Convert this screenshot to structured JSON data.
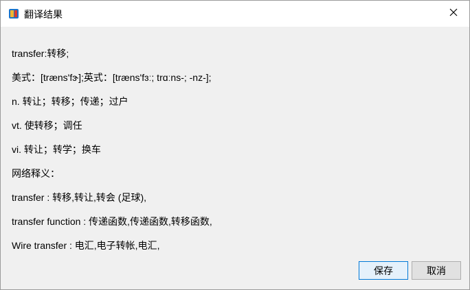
{
  "window": {
    "title": "翻译结果"
  },
  "content": {
    "lines": [
      "transfer:转移;",
      "美式：[træns'fɝ];英式：[træns'fɜː; trɑːns-; -nz-];",
      "n. 转让；转移；传递；过户",
      "vt. 使转移；调任",
      "vi. 转让；转学；换车",
      "网络释义：",
      "transfer : 转移,转让,转会 (足球),",
      "transfer function : 传递函数,传递函数,转移函数,",
      "Wire transfer : 电汇,电子转帐,电汇,"
    ]
  },
  "buttons": {
    "save": "保存",
    "cancel": "取消"
  },
  "icons": {
    "app": "translate-app-icon",
    "close": "close-icon"
  },
  "colors": {
    "accent": "#0078d7",
    "dialog_bg": "#f0f0f0"
  }
}
